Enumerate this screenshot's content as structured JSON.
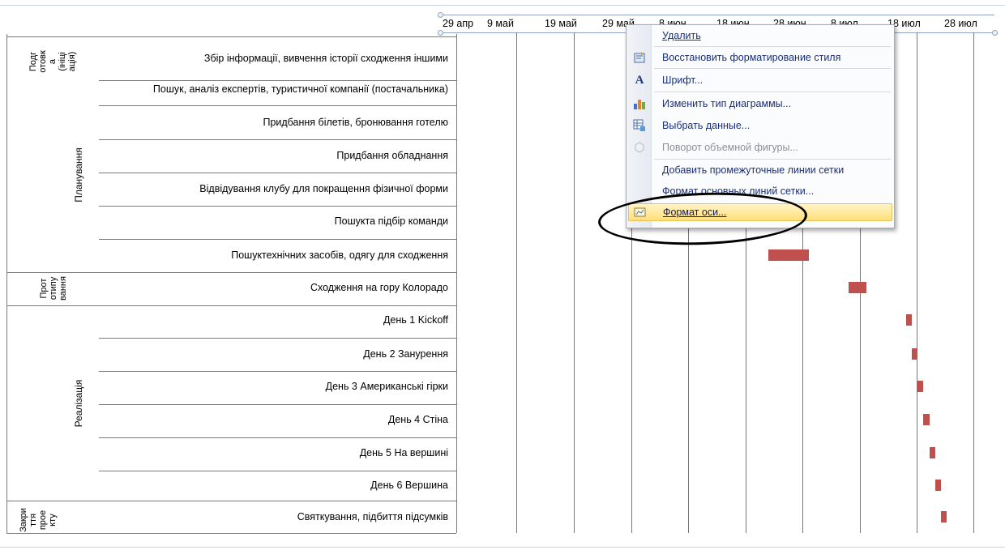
{
  "axis": {
    "ticks": [
      "29 апр",
      "9 май",
      "19 май",
      "29 май",
      "8 июн",
      "18 июн",
      "28 июн",
      "8 июл",
      "18 июл",
      "28 июл"
    ]
  },
  "phases": [
    {
      "label": "Подг\nотовк\nа\n(ініці\nація)"
    },
    {
      "label": "Планування"
    },
    {
      "label": "Прот\nотипу\nвання"
    },
    {
      "label": "Реалізація"
    },
    {
      "label": "Закри\nття\nпрое\nкту"
    }
  ],
  "tasks": [
    "Збір інформації, вивчення історії сходження іншими",
    "Пошук, аналіз експертів, туристичної компанії (постачальника)",
    "Придбання білетів, бронювання готелю",
    "Придбання обладнання",
    "Відвідування клубу для покращення фізичної форми",
    "Пошукта підбір команди",
    "Пошуктехнічних засобів, одягу для сходження",
    "Сходження на гору Колорадо",
    "День 1 Kickoff",
    "День 2 Занурення",
    "День 3 Американські гірки",
    "День 4 Стіна",
    "День 5 На вершині",
    "День 6 Вершина",
    "Святкування, підбиття підсумків"
  ],
  "chart_data": {
    "type": "bar",
    "orientation": "horizontal-gantt",
    "x_ticks": [
      "29 апр",
      "9 май",
      "19 май",
      "29 май",
      "8 июн",
      "18 июн",
      "28 июн",
      "8 июл",
      "18 июл",
      "28 июл"
    ],
    "visible_bars": [
      {
        "task": "Пошукта підбір команди",
        "start": "2013-06-22",
        "end": "2013-06-29"
      },
      {
        "task": "Пошуктехнічних засобів, одягу для сходження",
        "start": "2013-06-22",
        "end": "2013-06-29"
      },
      {
        "task": "Сходження на гору Колорадо",
        "start": "2013-07-06",
        "end": "2013-07-09"
      },
      {
        "task": "День 1 Kickoff",
        "start": "2013-07-16",
        "end": "2013-07-17"
      },
      {
        "task": "День 2 Занурення",
        "start": "2013-07-17",
        "end": "2013-07-18"
      },
      {
        "task": "День 3 Американські гірки",
        "start": "2013-07-18",
        "end": "2013-07-19"
      },
      {
        "task": "День 4 Стіна",
        "start": "2013-07-19",
        "end": "2013-07-20"
      },
      {
        "task": "День 5 На вершині",
        "start": "2013-07-20",
        "end": "2013-07-21"
      },
      {
        "task": "День 6 Вершина",
        "start": "2013-07-21",
        "end": "2013-07-22"
      },
      {
        "task": "Святкування, підбиття підсумків",
        "start": "2013-07-22",
        "end": "2013-07-23"
      }
    ],
    "bar_color": "#c0504d"
  },
  "context_menu": {
    "items": [
      {
        "label": "Удалить",
        "icon": "none",
        "disabled": false
      },
      {
        "label": "Восстановить форматирование стиля",
        "icon": "reset-style-icon",
        "disabled": false
      },
      {
        "label": "Шрифт...",
        "icon": "font-icon",
        "disabled": false
      },
      {
        "label": "Изменить тип диаграммы...",
        "icon": "chart-type-icon",
        "disabled": false
      },
      {
        "label": "Выбрать данные...",
        "icon": "select-data-icon",
        "disabled": false
      },
      {
        "label": "Поворот объемной фигуры...",
        "icon": "3d-rotation-icon",
        "disabled": true
      },
      {
        "label": "Добавить промежуточные линии сетки",
        "icon": "none",
        "disabled": false
      },
      {
        "label": "Формат основных линий сетки...",
        "icon": "none",
        "disabled": false
      },
      {
        "label": "Формат оси...",
        "icon": "format-axis-icon",
        "disabled": false,
        "highlighted": true
      }
    ]
  },
  "colors": {
    "bar": "#c0504d",
    "menu_text": "#1a2f7a",
    "highlight": "#ffdf7a"
  }
}
